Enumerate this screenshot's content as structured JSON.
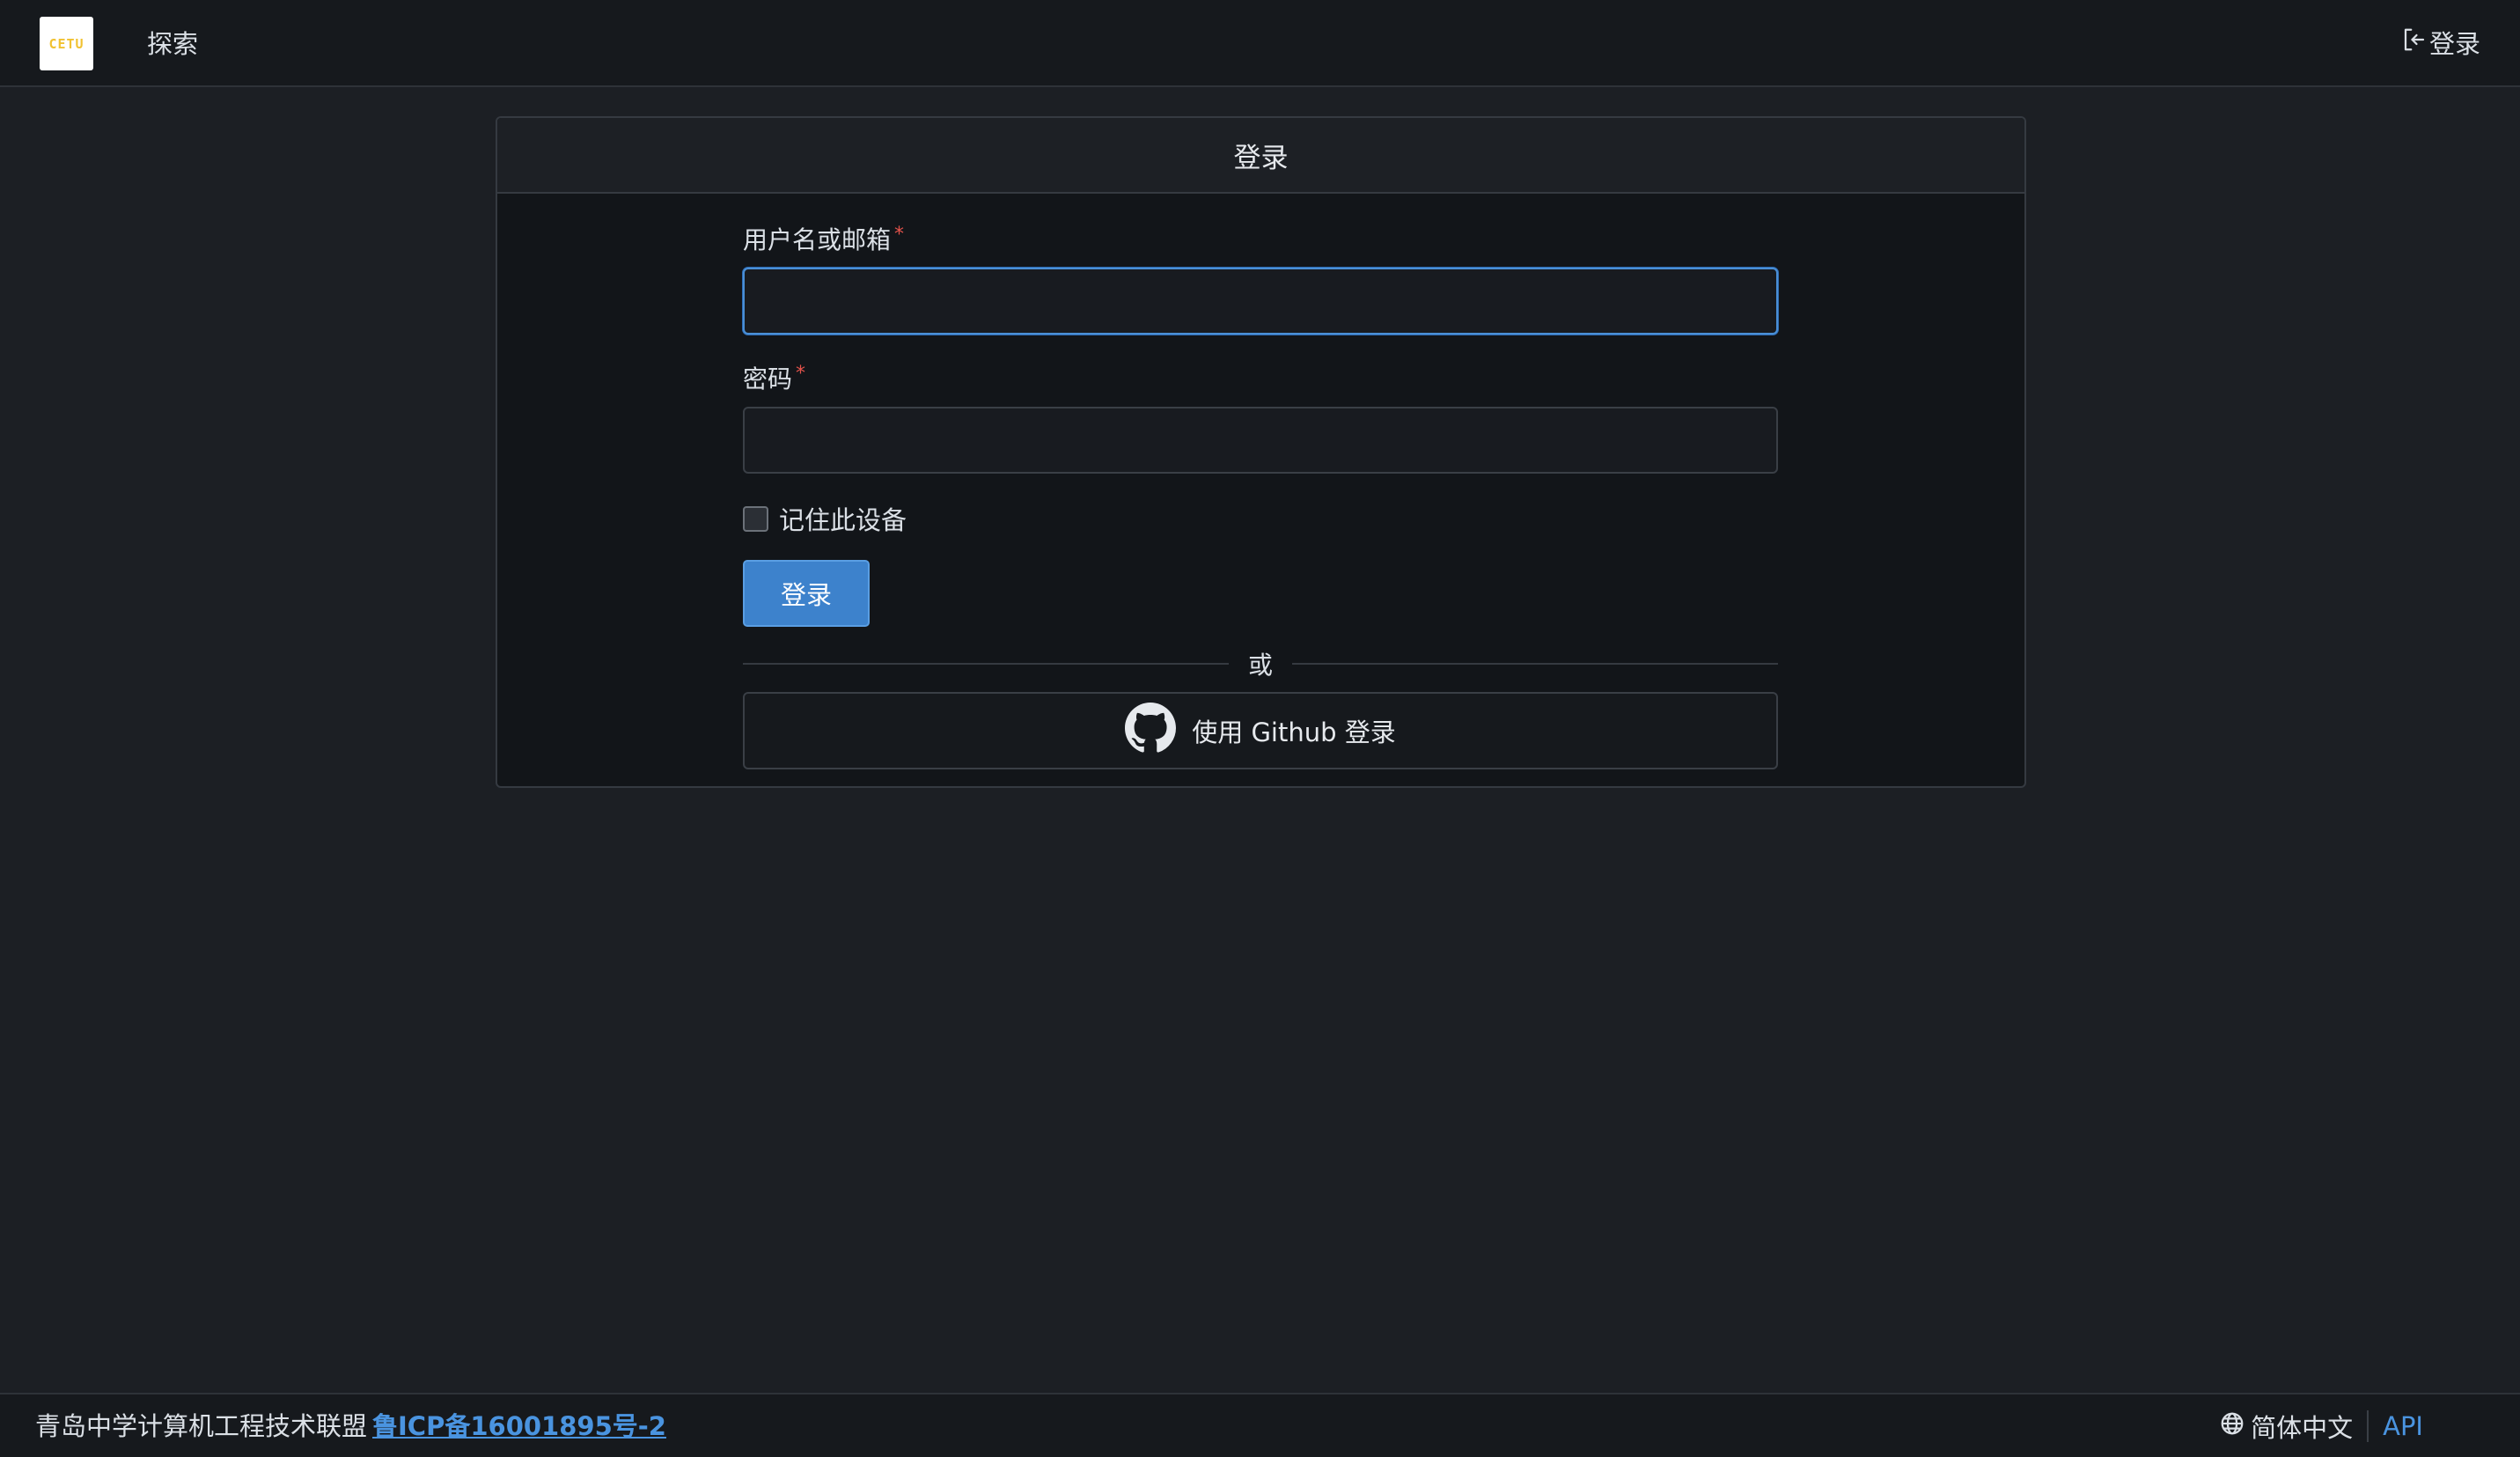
{
  "navbar": {
    "logo_text": "CETU",
    "explore_label": "探索",
    "login_label": "登录",
    "login_icon": "sign-in-icon"
  },
  "card": {
    "title": "登录",
    "username": {
      "label": "用户名或邮箱",
      "required_mark": "*",
      "value": ""
    },
    "password": {
      "label": "密码",
      "required_mark": "*",
      "value": ""
    },
    "remember_label": "记住此设备",
    "remember_checked": false,
    "submit_label": "登录",
    "divider_text": "或",
    "github_label": "使用 Github 登录",
    "github_icon": "github-icon"
  },
  "footer": {
    "org_text": "青岛中学计算机工程技术联盟",
    "icp_link": "鲁ICP备16001895号-2",
    "language": "简体中文",
    "language_icon": "globe-icon",
    "api_link": "API"
  },
  "colors": {
    "accent": "#3d82cc",
    "link": "#4a94e0",
    "required": "#e5534b",
    "background": "#1c1f24"
  }
}
